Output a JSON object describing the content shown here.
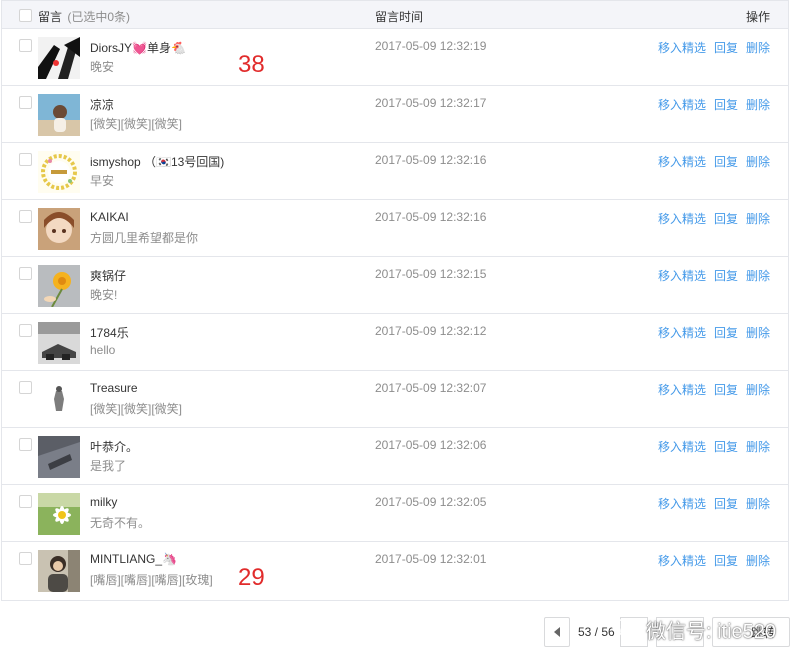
{
  "header": {
    "message_label": "留言",
    "selected_label": "(已选中0条)",
    "time_label": "留言时间",
    "op_label": "操作"
  },
  "actions": {
    "feature": "移入精选",
    "reply": "回复",
    "delete": "删除"
  },
  "rows": [
    {
      "name": "DiorsJY💓单身🐔",
      "content": "晚安",
      "time": "2017-05-09 12:32:19",
      "mark": "38"
    },
    {
      "name": "凉凉",
      "content": "[微笑][微笑][微笑]",
      "time": "2017-05-09 12:32:17",
      "mark": ""
    },
    {
      "name": "ismyshop （🇰🇷13号回国)",
      "content": "早安",
      "time": "2017-05-09 12:32:16",
      "mark": ""
    },
    {
      "name": "KAIKAI",
      "content": "方圆几里希望都是你",
      "time": "2017-05-09 12:32:16",
      "mark": ""
    },
    {
      "name": "爽锅仔",
      "content": "晚安!",
      "time": "2017-05-09 12:32:15",
      "mark": ""
    },
    {
      "name": "1784乐",
      "content": "hello",
      "time": "2017-05-09 12:32:12",
      "mark": ""
    },
    {
      "name": "Treasure",
      "content": "[微笑][微笑][微笑]",
      "time": "2017-05-09 12:32:07",
      "mark": ""
    },
    {
      "name": "叶恭介。",
      "content": "是我了",
      "time": "2017-05-09 12:32:06",
      "mark": ""
    },
    {
      "name": "milky",
      "content": "无奇不有。",
      "time": "2017-05-09 12:32:05",
      "mark": ""
    },
    {
      "name": "MINTLIANG_🦄",
      "content": "[嘴唇][嘴唇][嘴唇][玫瑰]",
      "time": "2017-05-09 12:32:01",
      "mark": "29"
    }
  ],
  "pagination": {
    "page_text": "53 / 56",
    "go_label": "跳转"
  },
  "watermark": {
    "text": "微信号: itie520"
  },
  "colors": {
    "link": "#459ae9",
    "annotation": "#e12b2b",
    "header_bg": "#f4f5f9"
  }
}
